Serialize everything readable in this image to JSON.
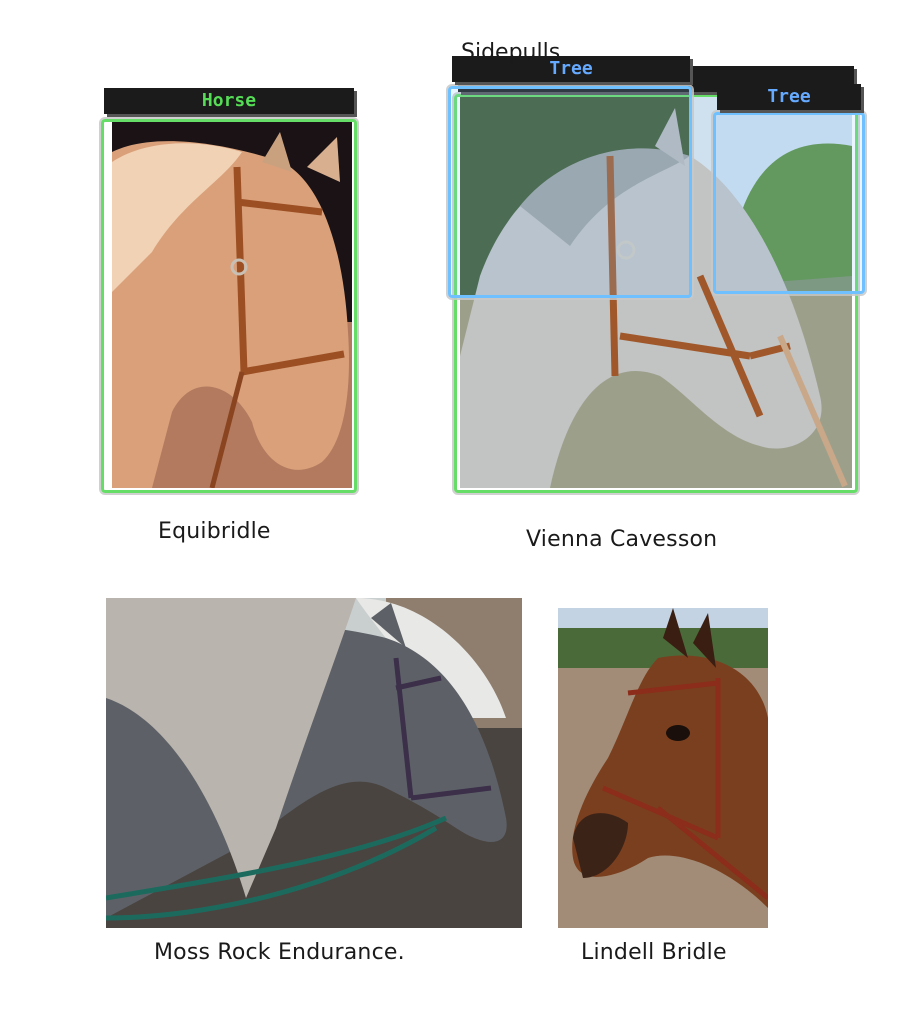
{
  "captions": {
    "equibridle": "Equibridle",
    "vienna": "Vienna Cavesson",
    "sidepulls": "Sidepulls",
    "moss_rock": "Moss Rock Endurance.",
    "lindell": "Lindell Bridle"
  },
  "detections": {
    "equibridle_horse": "Horse",
    "vienna_horse": "Horse",
    "vienna_tree_left": "Tree",
    "vienna_tree_right": "Tree"
  },
  "colors": {
    "horse_box": "#66dd66",
    "tree_box": "#6ec0ff",
    "label_bg": "#1b1b1b"
  }
}
